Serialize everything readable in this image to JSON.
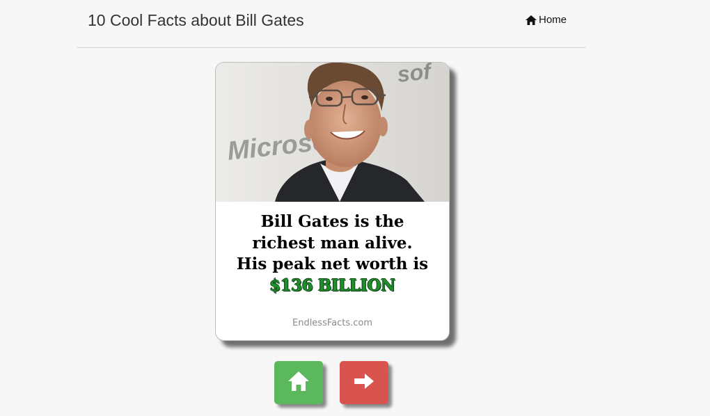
{
  "header": {
    "title": "10 Cool Facts about Bill Gates",
    "home_link_label": "Home",
    "home_icon": "house-icon"
  },
  "fact_card": {
    "photo_logo_text": "Microso",
    "photo_logo_text_right": "sof",
    "caption_lines": [
      "Bill Gates is the",
      "richest man alive.",
      "His peak net worth is"
    ],
    "highlight": "$136 BILLION",
    "watermark": "EndlessFacts.com"
  },
  "navigation": {
    "home_button_icon": "house-icon",
    "next_button_icon": "arrow-right-icon"
  },
  "colors": {
    "background": "#f7f7f7",
    "home_button": "#5cb85c",
    "next_button": "#d9534f",
    "money_text": "#1e8f2b"
  }
}
